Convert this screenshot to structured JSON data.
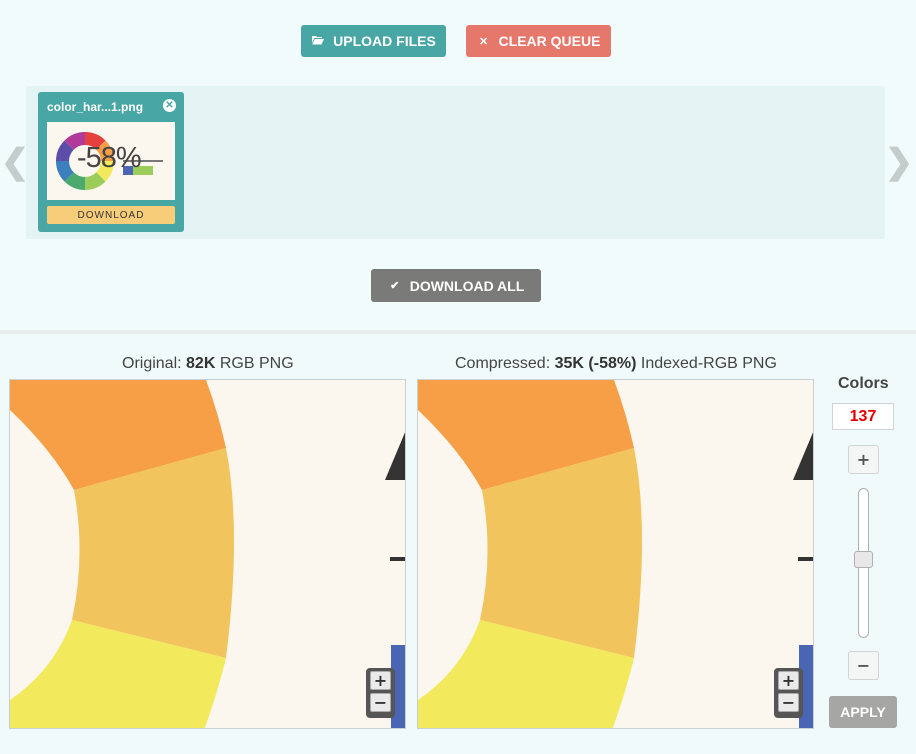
{
  "toolbar": {
    "upload_label": "UPLOAD FILES",
    "clear_label": "CLEAR QUEUE",
    "download_all_label": "DOWNLOAD ALL"
  },
  "queue": {
    "prev_arrow": "❮",
    "next_arrow": "❯",
    "files": [
      {
        "name": "color_har...1.png",
        "thumb_percent": "-58%",
        "download_label": "DOWNLOAD"
      }
    ]
  },
  "compare": {
    "original": {
      "prefix": "Original:",
      "size": "82K",
      "format": "RGB PNG"
    },
    "compressed": {
      "prefix": "Compressed:",
      "size": "35K (-58%)",
      "format": "Indexed-RGB PNG"
    },
    "zoom_in": "+",
    "zoom_out": "−"
  },
  "colors": {
    "title": "Colors",
    "value": "137",
    "increment": "+",
    "decrement": "−",
    "slider_fraction": 0.47,
    "apply_label": "APPLY"
  },
  "palette": {
    "teal": "#48a6a4",
    "coral": "#e6776b",
    "gray": "#7a7a78",
    "orange": "#f69f46",
    "amber": "#f2c45e",
    "yellow": "#f2ea5c",
    "blue": "#4a65b3",
    "cream": "#fbf7ef",
    "value_red": "#e10000"
  }
}
